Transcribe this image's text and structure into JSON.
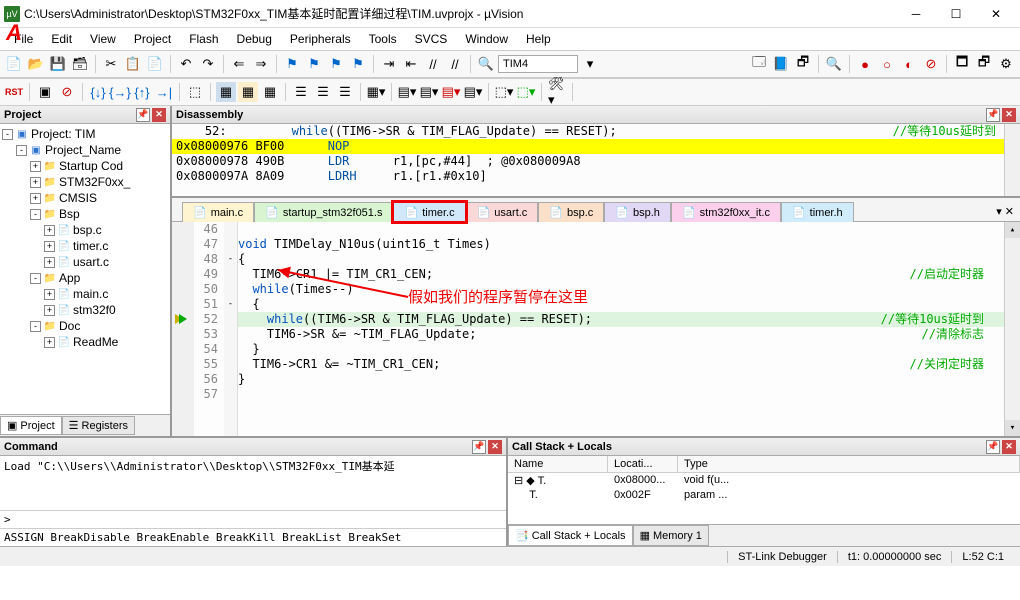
{
  "window": {
    "title": "C:\\Users\\Administrator\\Desktop\\STM32F0xx_TIM基本延时配置详细过程\\TIM.uvprojx - µVision",
    "app_icon_text": "µV"
  },
  "menubar": [
    "File",
    "Edit",
    "View",
    "Project",
    "Flash",
    "Debug",
    "Peripherals",
    "Tools",
    "SVCS",
    "Window",
    "Help"
  ],
  "toolbar_text": {
    "target": "TIM4"
  },
  "annotation_a": "A",
  "project": {
    "panel_title": "Project",
    "root": "Project: TIM",
    "target": "Project_Name",
    "groups": [
      {
        "name": "Startup Cod",
        "files": []
      },
      {
        "name": "STM32F0xx_",
        "files": []
      },
      {
        "name": "CMSIS",
        "files": []
      },
      {
        "name": "Bsp",
        "files": [
          "bsp.c",
          "timer.c",
          "usart.c"
        ],
        "expanded": true
      },
      {
        "name": "App",
        "files": [
          "main.c",
          "stm32f0"
        ],
        "expanded": true
      },
      {
        "name": "Doc",
        "files": [
          "ReadMe"
        ],
        "expanded": true
      }
    ],
    "bottom_tabs": {
      "project": "Project",
      "registers": "Registers"
    }
  },
  "disassembly": {
    "title": "Disassembly",
    "lines": [
      {
        "pre": "    52:         ",
        "kw": "while",
        "rest": "((TIM6->SR & TIM_FLAG_Update) == RESET);",
        "comment": "//等待10us延时到",
        "hl": false
      },
      {
        "pre": "0x08000976 BF00      ",
        "op": "NOP",
        "args": "",
        "hl": true
      },
      {
        "pre": "0x08000978 490B      ",
        "op": "LDR",
        "args": "      r1,[pc,#44]  ; @0x080009A8",
        "hl": false
      },
      {
        "pre": "0x0800097A 8A09      ",
        "op": "LDRH",
        "args": "     r1.[r1.#0x10]",
        "hl": false
      }
    ]
  },
  "editor": {
    "tabs": [
      {
        "name": "main.c",
        "cls": "c1"
      },
      {
        "name": "startup_stm32f051.s",
        "cls": "c2"
      },
      {
        "name": "timer.c",
        "cls": "c3",
        "active": true
      },
      {
        "name": "usart.c",
        "cls": "c4"
      },
      {
        "name": "bsp.c",
        "cls": "c5"
      },
      {
        "name": "bsp.h",
        "cls": "c6"
      },
      {
        "name": "stm32f0xx_it.c",
        "cls": "c7"
      },
      {
        "name": "timer.h",
        "cls": "c8"
      }
    ],
    "lines": [
      {
        "n": 46,
        "text": ""
      },
      {
        "n": 47,
        "text": "void TIMDelay_N10us(uint16_t Times)",
        "kw": "void"
      },
      {
        "n": 48,
        "text": "{",
        "fold": "-"
      },
      {
        "n": 49,
        "text": "  TIM6->CR1 |= TIM_CR1_CEN;",
        "comment": "//启动定时器"
      },
      {
        "n": 50,
        "text": "  while(Times--)",
        "kw": "while"
      },
      {
        "n": 51,
        "text": "  {",
        "fold": "-"
      },
      {
        "n": 52,
        "text": "    while((TIM6->SR & TIM_FLAG_Update) == RESET);",
        "kw": "while",
        "comment": "//等待10us延时到",
        "current": true,
        "bp": true
      },
      {
        "n": 53,
        "text": "    TIM6->SR &= ~TIM_FLAG_Update;",
        "comment": "//清除标志"
      },
      {
        "n": 54,
        "text": "  }"
      },
      {
        "n": 55,
        "text": "  TIM6->CR1 &= ~TIM_CR1_CEN;",
        "comment": "//关闭定时器"
      },
      {
        "n": 56,
        "text": "}"
      },
      {
        "n": 57,
        "text": ""
      }
    ],
    "red_annotation": "假如我们的程序暂停在这里"
  },
  "command": {
    "title": "Command",
    "body": "Load \"C:\\\\Users\\\\Administrator\\\\Desktop\\\\STM32F0xx_TIM基本延",
    "prompt": ">",
    "footer": "ASSIGN BreakDisable BreakEnable BreakKill BreakList BreakSet"
  },
  "callstack": {
    "title": "Call Stack + Locals",
    "headers": {
      "name": "Name",
      "location": "Locati...",
      "type": "Type"
    },
    "rows": [
      {
        "name": "T.",
        "loc": "0x08000...",
        "type": "void f(u..."
      },
      {
        "name": "T.",
        "loc": "0x002F",
        "type": "param ..."
      }
    ],
    "tabs": {
      "stack": "Call Stack + Locals",
      "mem": "Memory 1"
    }
  },
  "statusbar": {
    "debugger": "ST-Link Debugger",
    "time": "t1: 0.00000000 sec",
    "pos": "L:52 C:1"
  }
}
